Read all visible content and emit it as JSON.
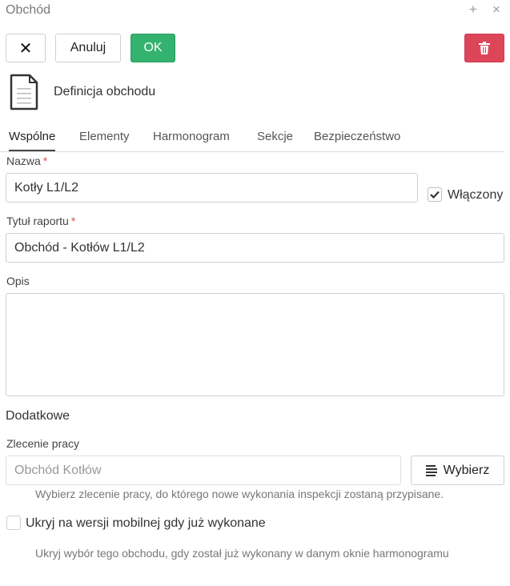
{
  "window": {
    "title": "Obchód",
    "plus_icon": "plus-icon",
    "close_icon": "close-icon"
  },
  "toolbar": {
    "close_symbol": "✕",
    "cancel_label": "Anuluj",
    "ok_label": "OK",
    "delete_icon": "trash-icon",
    "ok_color": "#34b26f",
    "delete_color": "#dd4559"
  },
  "header": {
    "icon": "document-icon",
    "title": "Definicja obchodu"
  },
  "tabs": [
    {
      "label": "Wspólne",
      "active": true
    },
    {
      "label": "Elementy",
      "active": false
    },
    {
      "label": "Harmonogram",
      "active": false
    },
    {
      "label": "Sekcje",
      "active": false
    },
    {
      "label": "Bezpieczeństwo",
      "active": false
    }
  ],
  "form": {
    "name_label": "Nazwa",
    "required_mark": "*",
    "name_value": "Kotły L1/L2",
    "enabled_label": "Włączony",
    "enabled_checked": true,
    "report_title_label": "Tytuł raportu",
    "report_title_value": "Obchód - Kotłów L1/L2",
    "description_label": "Opis",
    "description_value": "",
    "additional_section": "Dodatkowe",
    "work_order_label": "Zlecenie pracy",
    "work_order_placeholder": "Obchód Kotłów",
    "choose_label": "Wybierz",
    "choose_icon": "list-icon",
    "work_order_help": "Wybierz zlecenie pracy, do którego nowe wykonania inspekcji zostaną przypisane.",
    "hide_mobile_label": "Ukryj na wersji mobilnej gdy już wykonane",
    "hide_mobile_checked": false,
    "hide_mobile_help": "Ukryj wybór tego obchodu, gdy został już wykonany w danym oknie harmonogramu"
  }
}
